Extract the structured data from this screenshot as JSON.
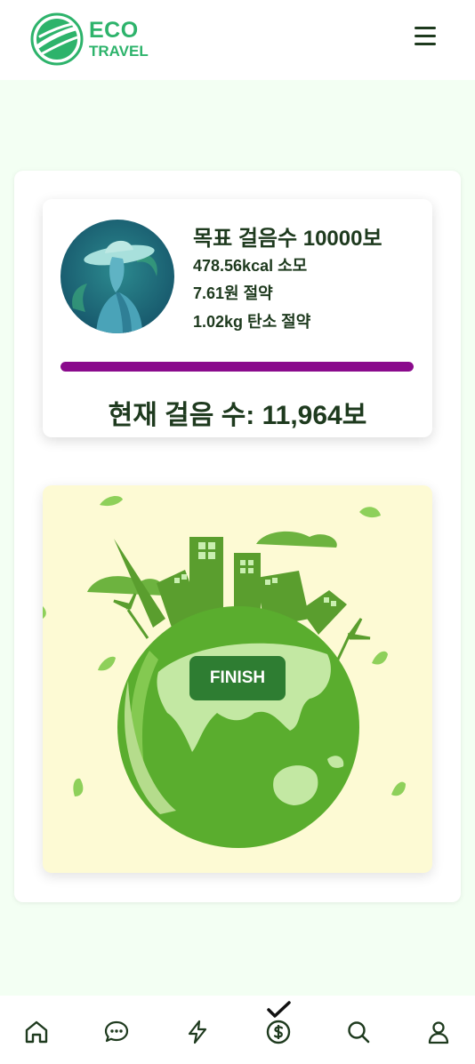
{
  "header": {
    "brand_line1": "ECO",
    "brand_line2": "TRAVEL",
    "menu_icon": "hamburger-menu-icon"
  },
  "stats": {
    "goal_title": "목표 걸음수 10000보",
    "calories": "478.56kcal 소모",
    "savings": "7.61원 절약",
    "carbon": "1.02kg 탄소 절약",
    "progress": 1.0,
    "progress_color": "#8a0a8c",
    "current_steps": "현재 걸음 수: 11,964보"
  },
  "earth": {
    "finish_label": "FINISH"
  },
  "bottom_nav": {
    "items": [
      {
        "icon": "home-icon"
      },
      {
        "icon": "chat-icon"
      },
      {
        "icon": "lightning-icon"
      },
      {
        "icon": "dollar-coin-icon",
        "active": true
      },
      {
        "icon": "search-icon"
      },
      {
        "icon": "user-icon"
      }
    ]
  },
  "colors": {
    "brand": "#2db36b",
    "text": "#1e3a1e",
    "page_bg": "#f3fff3",
    "finish_button": "#2e7d32"
  }
}
